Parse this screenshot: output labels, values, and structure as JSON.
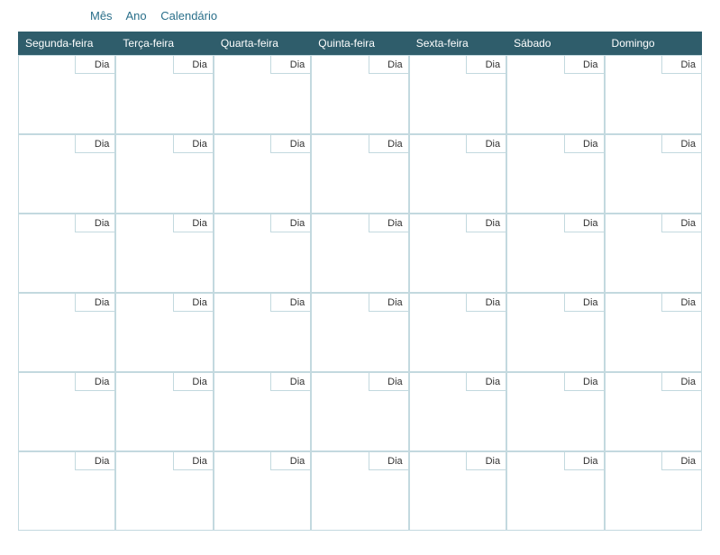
{
  "header": {
    "month_label": "Mês",
    "year_label": "Ano",
    "calendar_label": "Calendário"
  },
  "weekdays": [
    "Segunda-feira",
    "Terça-feira",
    "Quarta-feira",
    "Quinta-feira",
    "Sexta-feira",
    "Sábado",
    "Domingo"
  ],
  "day_placeholder": "Dia",
  "rows": 6,
  "cols": 7
}
